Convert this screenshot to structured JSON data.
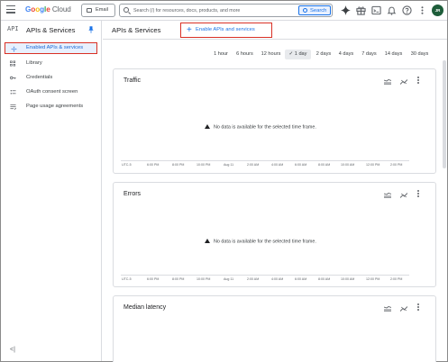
{
  "topbar": {
    "logo": {
      "g": "G",
      "o1": "o",
      "o2": "o",
      "g2": "g",
      "l": "l",
      "e": "e",
      "cloud": "Cloud"
    },
    "project_label": "Email",
    "search_placeholder": "Search (/) for resources, docs, products, and more",
    "search_button": "Search",
    "avatar_initials": "JR",
    "icons": [
      "gemini-icon",
      "gift-icon",
      "terminal-icon",
      "notifications-icon",
      "help-icon",
      "more-vert-icon"
    ]
  },
  "sidebar": {
    "api_mark": "API",
    "title": "APIs & Services",
    "items": [
      {
        "label": "Enabled APIs & services",
        "icon": "apis-icon",
        "active": true
      },
      {
        "label": "Library",
        "icon": "library-icon",
        "active": false
      },
      {
        "label": "Credentials",
        "icon": "key-icon",
        "active": false
      },
      {
        "label": "OAuth consent screen",
        "icon": "consent-icon",
        "active": false
      },
      {
        "label": "Page usage agreements",
        "icon": "agreements-icon",
        "active": false
      }
    ],
    "collapse_label": "<|"
  },
  "main": {
    "title": "APIs & Services",
    "enable_button": "Enable APIs and services",
    "ranges": [
      "1 hour",
      "6 hours",
      "12 hours",
      "1 day",
      "2 days",
      "4 days",
      "7 days",
      "14 days",
      "30 days"
    ],
    "selected_range": "1 day",
    "selected_range_mark": "✓",
    "cards": [
      {
        "title": "Traffic",
        "message": "No data is available for the selected time frame."
      },
      {
        "title": "Errors",
        "message": "No data is available for the selected time frame."
      },
      {
        "title": "Median latency",
        "message": ""
      }
    ],
    "axis_ticks": [
      "UTC-5",
      "6:00 PM",
      "8:00 PM",
      "10:00 PM",
      "Aug 11",
      "2:00 AM",
      "4:00 AM",
      "6:00 AM",
      "8:00 AM",
      "10:00 AM",
      "12:00 PM",
      "2:00 PM"
    ]
  },
  "colors": {
    "accent": "#1a73e8",
    "highlight": "#d93025",
    "active_bg": "#e8f0fe"
  }
}
